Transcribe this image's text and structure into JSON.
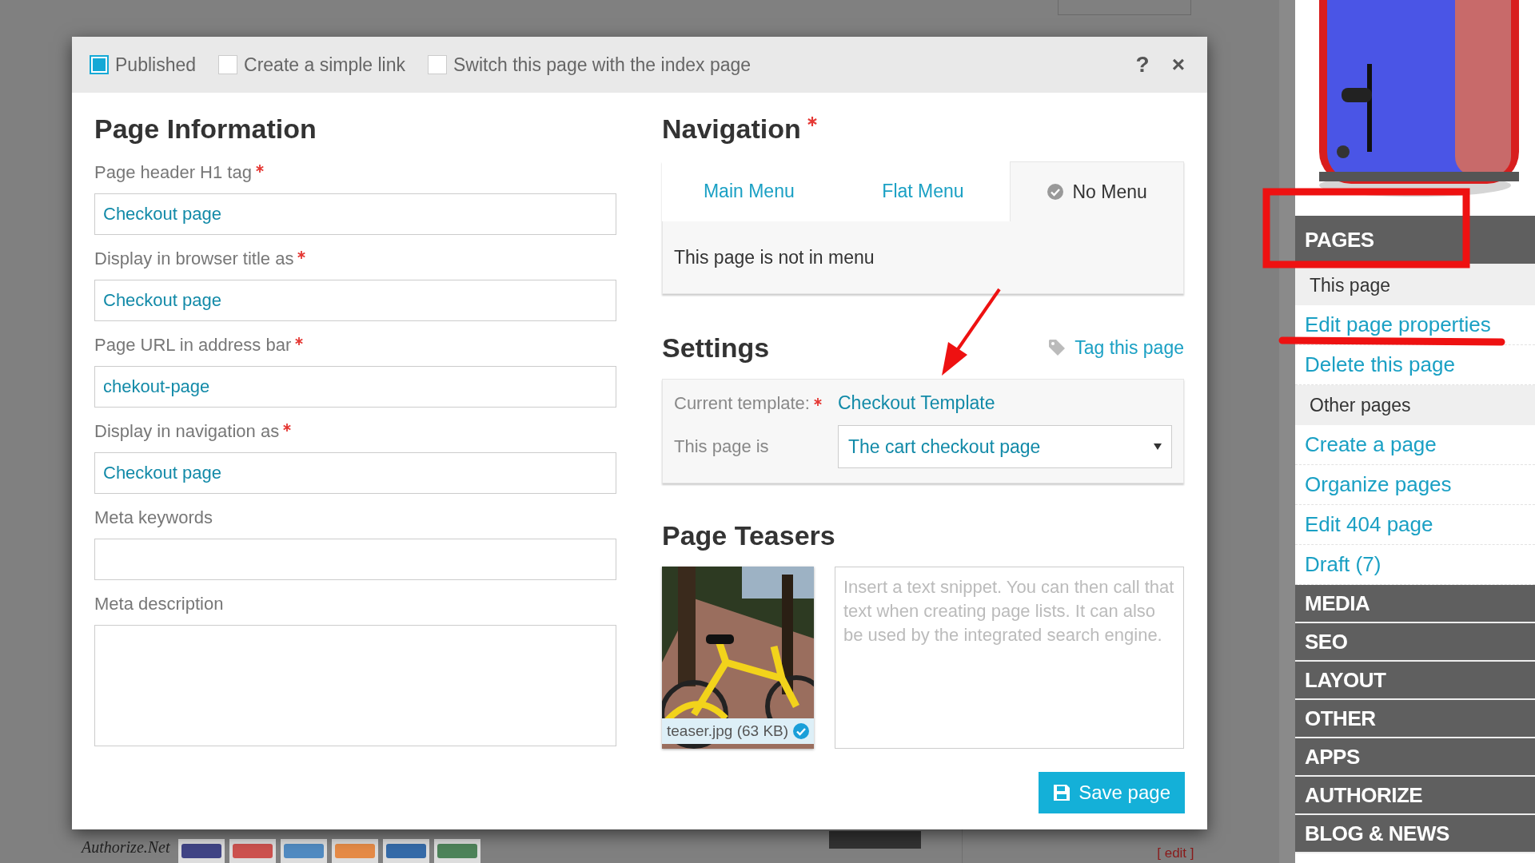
{
  "background_page": {
    "payment_logo": "Authorize.Net",
    "edit_link": "[ edit ]"
  },
  "dialog": {
    "options": [
      {
        "label": "Published",
        "checked": true
      },
      {
        "label": "Create a simple link",
        "checked": false
      },
      {
        "label": "Switch this page with the index page",
        "checked": false
      }
    ],
    "help_button": "?",
    "close_button": "×"
  },
  "page_information": {
    "title": "Page Information",
    "fields": [
      {
        "kind": "input",
        "label": "Page header H1 tag",
        "required": true,
        "value": "Checkout page"
      },
      {
        "kind": "input",
        "label": "Display in browser title as",
        "required": true,
        "value": "Checkout page"
      },
      {
        "kind": "input",
        "label": "Page URL in address bar",
        "required": true,
        "value": "chekout-page"
      },
      {
        "kind": "input",
        "label": "Display in navigation as",
        "required": true,
        "value": "Checkout page"
      },
      {
        "kind": "input",
        "label": "Meta keywords",
        "required": false
      },
      {
        "kind": "textarea",
        "label": "Meta description",
        "required": false
      }
    ]
  },
  "navigation": {
    "title": "Navigation",
    "required": true,
    "tabs": [
      {
        "label": "Main Menu",
        "selected": false
      },
      {
        "label": "Flat Menu",
        "selected": false
      },
      {
        "label": "No Menu",
        "selected": true
      }
    ],
    "panel_text": "This page is not in menu"
  },
  "settings": {
    "title": "Settings",
    "tag_link": "Tag this page",
    "template_label": "Current template:",
    "template_required": true,
    "template_value": "Checkout Template",
    "page_is_label": "This page is",
    "page_is_value": "The cart checkout page"
  },
  "page_teasers": {
    "title": "Page Teasers",
    "image_caption": "teaser.jpg (63 KB)",
    "image_verified": true,
    "placeholder": "Insert a text snippet. You can then call that text when creating page lists. It can also be used by the integrated search engine."
  },
  "save_button": "Save page",
  "sidebar": {
    "sections": [
      {
        "title": "PAGES",
        "items": [
          {
            "kind": "group",
            "label": "This page"
          },
          {
            "kind": "link",
            "label": "Edit page properties"
          },
          {
            "kind": "link",
            "label": "Delete this page"
          },
          {
            "kind": "group",
            "label": "Other pages"
          },
          {
            "kind": "link",
            "label": "Create a page"
          },
          {
            "kind": "link",
            "label": "Organize pages"
          },
          {
            "kind": "link",
            "label": "Edit 404 page"
          },
          {
            "kind": "link",
            "label": "Draft (7)"
          }
        ]
      },
      {
        "title": "MEDIA"
      },
      {
        "title": "SEO"
      },
      {
        "title": "LAYOUT"
      },
      {
        "title": "OTHER"
      },
      {
        "title": "APPS"
      },
      {
        "title": "AUTHORIZE"
      },
      {
        "title": "BLOG & NEWS"
      }
    ]
  }
}
